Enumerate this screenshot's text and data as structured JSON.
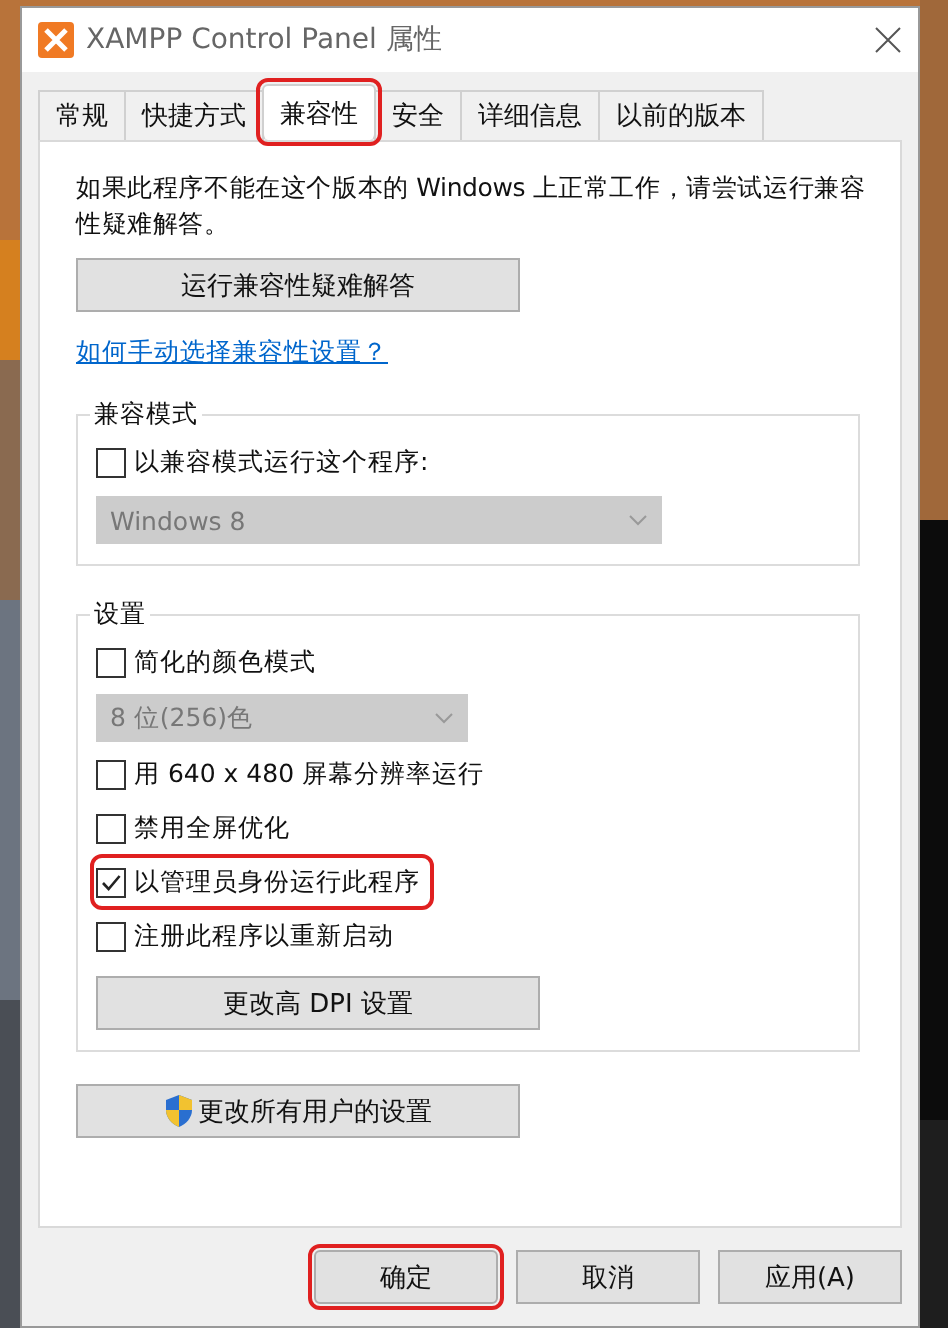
{
  "window": {
    "title": "XAMPP Control Panel 属性"
  },
  "tabs": [
    {
      "label": "常规",
      "selected": false,
      "highlighted": false
    },
    {
      "label": "快捷方式",
      "selected": false,
      "highlighted": false
    },
    {
      "label": "兼容性",
      "selected": true,
      "highlighted": true
    },
    {
      "label": "安全",
      "selected": false,
      "highlighted": false
    },
    {
      "label": "详细信息",
      "selected": false,
      "highlighted": false
    },
    {
      "label": "以前的版本",
      "selected": false,
      "highlighted": false
    }
  ],
  "intro": "如果此程序不能在这个版本的 Windows 上正常工作，请尝试运行兼容性疑难解答。",
  "troubleshoot_button": "运行兼容性疑难解答",
  "help_link": "如何手动选择兼容性设置？",
  "compat_mode": {
    "title": "兼容模式",
    "items": [
      {
        "kind": "checkbox",
        "label": "以兼容模式运行这个程序:",
        "checked": false,
        "highlighted": false
      },
      {
        "kind": "dropdown",
        "value": "Windows 8",
        "disabled": true
      }
    ]
  },
  "settings": {
    "title": "设置",
    "items": [
      {
        "kind": "checkbox",
        "label": "简化的颜色模式",
        "checked": false,
        "highlighted": false
      },
      {
        "kind": "dropdown",
        "value": "8 位(256)色",
        "disabled": true
      },
      {
        "kind": "checkbox",
        "label": "用 640 x 480 屏幕分辨率运行",
        "checked": false,
        "highlighted": false
      },
      {
        "kind": "checkbox",
        "label": "禁用全屏优化",
        "checked": false,
        "highlighted": false
      },
      {
        "kind": "checkbox",
        "label": "以管理员身份运行此程序",
        "checked": true,
        "highlighted": true
      },
      {
        "kind": "checkbox",
        "label": "注册此程序以重新启动",
        "checked": false,
        "highlighted": false
      },
      {
        "kind": "button",
        "label": "更改高 DPI 设置"
      }
    ]
  },
  "all_users_button": "更改所有用户的设置",
  "buttons": [
    {
      "label": "确定",
      "highlighted": true
    },
    {
      "label": "取消",
      "highlighted": false
    },
    {
      "label": "应用(A)",
      "highlighted": false
    }
  ]
}
